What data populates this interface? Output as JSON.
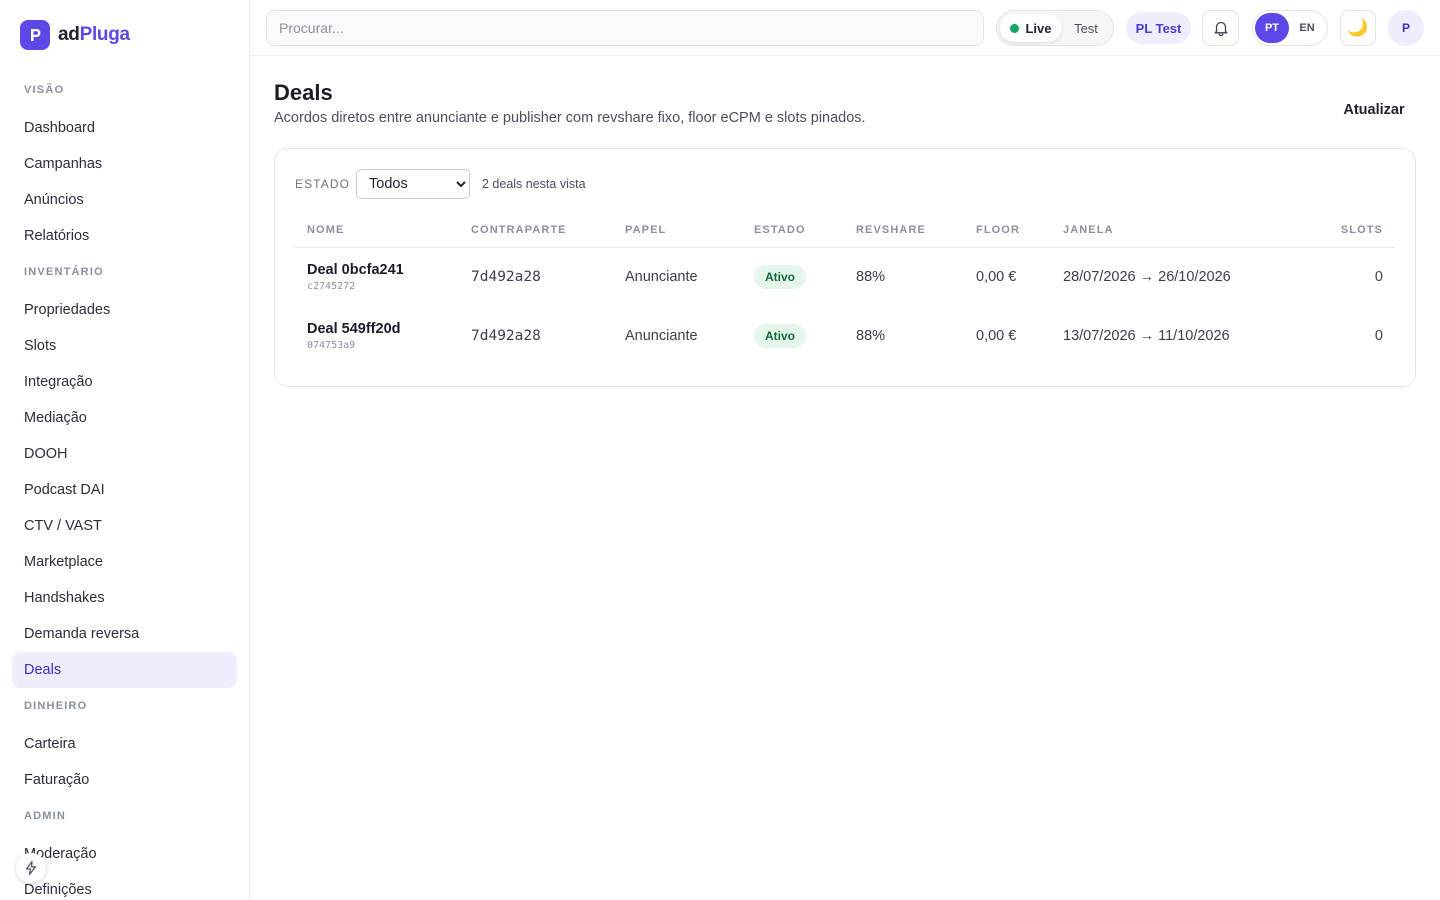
{
  "brand": {
    "name_part1": "ad",
    "name_part2": "Pluga",
    "logo_letter": "P"
  },
  "sidebar": {
    "groups": [
      {
        "label": "VISÃO",
        "items": [
          {
            "label": "Dashboard"
          },
          {
            "label": "Campanhas"
          },
          {
            "label": "Anúncios"
          },
          {
            "label": "Relatórios"
          }
        ]
      },
      {
        "label": "INVENTÁRIO",
        "items": [
          {
            "label": "Propriedades"
          },
          {
            "label": "Slots"
          },
          {
            "label": "Integração"
          },
          {
            "label": "Mediação"
          },
          {
            "label": "DOOH"
          },
          {
            "label": "Podcast DAI"
          },
          {
            "label": "CTV / VAST"
          },
          {
            "label": "Marketplace"
          },
          {
            "label": "Handshakes"
          },
          {
            "label": "Demanda reversa"
          },
          {
            "label": "Deals"
          }
        ]
      },
      {
        "label": "DINHEIRO",
        "items": [
          {
            "label": "Carteira"
          },
          {
            "label": "Faturação"
          }
        ]
      },
      {
        "label": "ADMIN",
        "items": [
          {
            "label": "Moderação"
          },
          {
            "label": "Definições"
          }
        ]
      }
    ],
    "active_item": "Deals",
    "quick_action_icon": "lightning-icon"
  },
  "topbar": {
    "search_placeholder": "Procurar...",
    "env_live": "Live",
    "env_test": "Test",
    "env_selected": "Live",
    "org_chip": "PL Test",
    "lang_pt": "PT",
    "lang_en": "EN",
    "lang_selected": "PT",
    "theme_icon": "🌙",
    "avatar_initial": "P"
  },
  "page": {
    "title": "Deals",
    "subtitle": "Acordos diretos entre anunciante e publisher com revshare fixo, floor eCPM e slots pinados.",
    "refresh_label": "Atualizar"
  },
  "filter": {
    "label": "ESTADO",
    "selected": "Todos",
    "count_text": "2 deals nesta vista"
  },
  "table": {
    "headers": {
      "name": "NOME",
      "counterpart": "CONTRAPARTE",
      "role": "PAPEL",
      "state": "ESTADO",
      "revshare": "REVSHARE",
      "floor": "FLOOR",
      "window": "JANELA",
      "slots": "SLOTS"
    },
    "rows": [
      {
        "name": "Deal 0bcfa241",
        "id": "c2745272",
        "counterpart": "7d492a28",
        "role": "Anunciante",
        "state": "Ativo",
        "revshare": "88%",
        "floor": "0,00 €",
        "window": "28/07/2026 → 26/10/2026",
        "slots": "0"
      },
      {
        "name": "Deal 549ff20d",
        "id": "074753a9",
        "counterpart": "7d492a28",
        "role": "Anunciante",
        "state": "Ativo",
        "revshare": "88%",
        "floor": "0,00 €",
        "window": "13/07/2026 → 11/10/2026",
        "slots": "0"
      }
    ]
  },
  "colors": {
    "accent": "#5b48e6",
    "accent_soft": "#eeedfd",
    "status_active_bg": "#e4f6ec",
    "status_active_text": "#15663d",
    "live_dot": "#11a56b"
  }
}
